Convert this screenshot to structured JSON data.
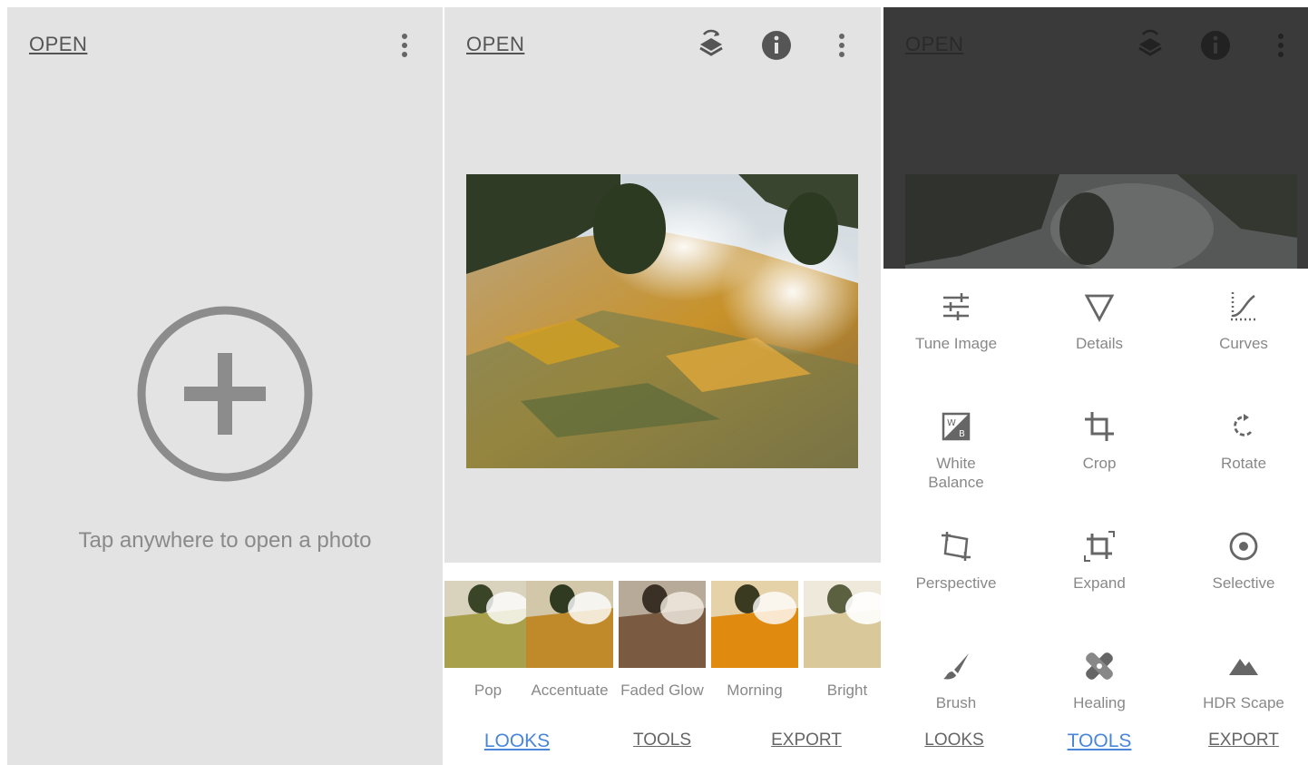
{
  "screen1": {
    "open_label": "OPEN",
    "tap_text": "Tap anywhere to open a photo"
  },
  "screen2": {
    "open_label": "OPEN",
    "looks": [
      {
        "label": "Pop"
      },
      {
        "label": "Accentuate"
      },
      {
        "label": "Faded Glow"
      },
      {
        "label": "Morning"
      },
      {
        "label": "Bright"
      }
    ],
    "tabs": {
      "looks": "LOOKS",
      "tools": "TOOLS",
      "export": "EXPORT"
    },
    "active_tab": "LOOKS"
  },
  "screen3": {
    "open_label": "OPEN",
    "tools": [
      {
        "label": "Tune Image",
        "icon": "sliders-icon"
      },
      {
        "label": "Details",
        "icon": "triangle-icon"
      },
      {
        "label": "Curves",
        "icon": "curves-icon"
      },
      {
        "label": "White Balance",
        "icon": "white-balance-icon"
      },
      {
        "label": "Crop",
        "icon": "crop-icon"
      },
      {
        "label": "Rotate",
        "icon": "rotate-icon"
      },
      {
        "label": "Perspective",
        "icon": "perspective-icon"
      },
      {
        "label": "Expand",
        "icon": "expand-icon"
      },
      {
        "label": "Selective",
        "icon": "selective-icon"
      },
      {
        "label": "Brush",
        "icon": "brush-icon"
      },
      {
        "label": "Healing",
        "icon": "healing-icon"
      },
      {
        "label": "HDR Scape",
        "icon": "mountain-icon"
      }
    ],
    "tabs": {
      "looks": "LOOKS",
      "tools": "TOOLS",
      "export": "EXPORT"
    },
    "active_tab": "TOOLS"
  },
  "colors": {
    "background_gray": "#e3e3e3",
    "active_tab_blue": "#4a86d8",
    "icon_gray": "#666666",
    "dim_overlay": "#3a3a3a"
  }
}
